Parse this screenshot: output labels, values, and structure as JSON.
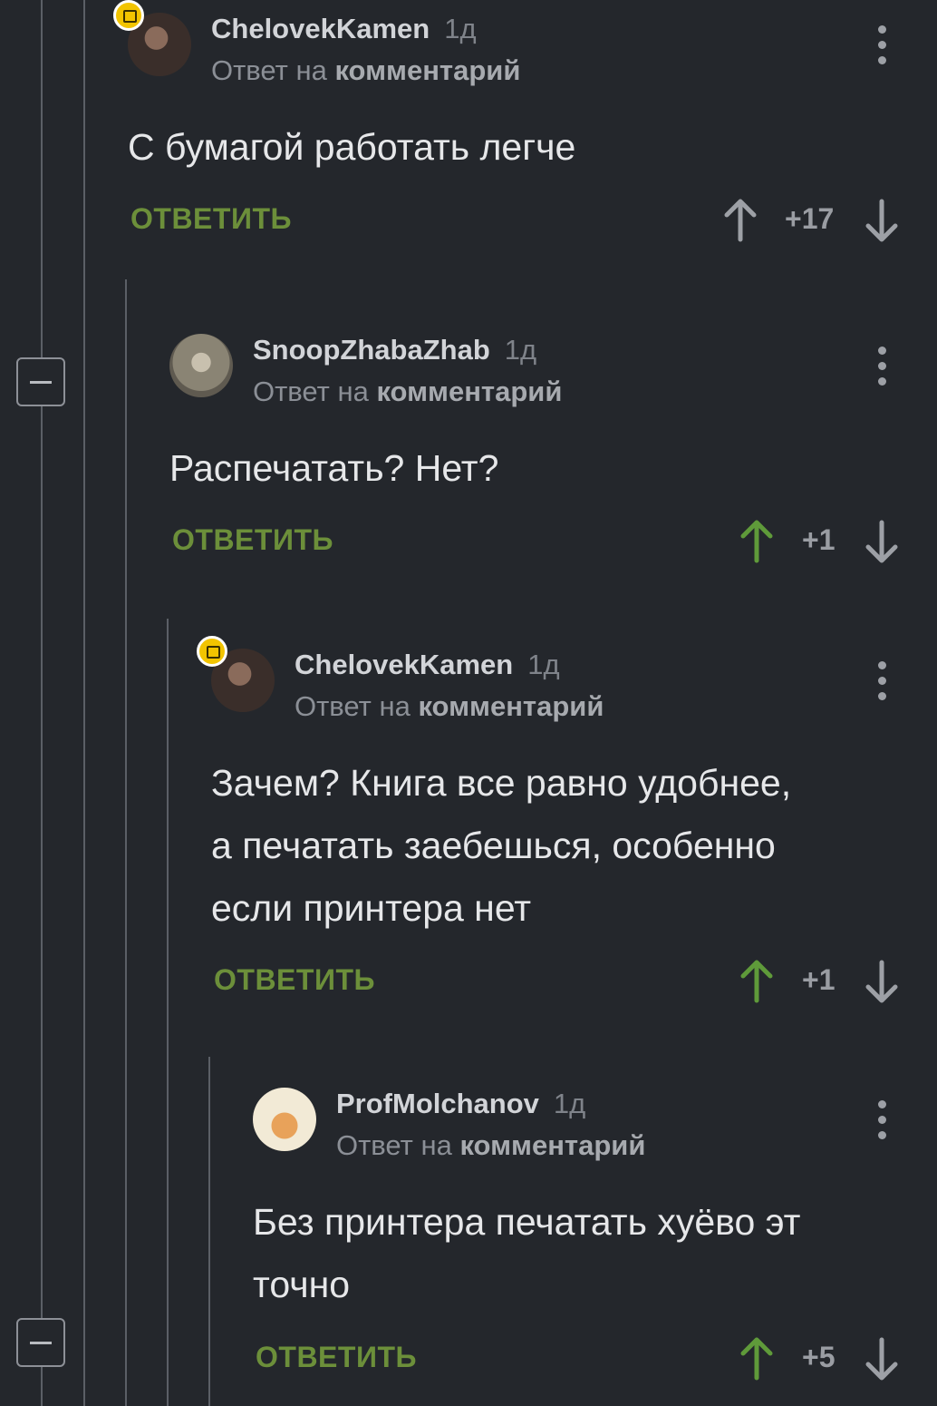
{
  "comments": [
    {
      "author": "ChelovekKamen",
      "time": "1д",
      "reply_prefix": "Ответ на",
      "reply_target": "комментарий",
      "text": "С бумагой работать легче",
      "reply_label": "ОТВЕТИТЬ",
      "rating": "+17",
      "upvoted": false
    },
    {
      "author": "SnoopZhabaZhab",
      "time": "1д",
      "reply_prefix": "Ответ на",
      "reply_target": "комментарий",
      "text": "Распечатать? Нет?",
      "reply_label": "ОТВЕТИТЬ",
      "rating": "+1",
      "upvoted": true
    },
    {
      "author": "ChelovekKamen",
      "time": "1д",
      "reply_prefix": "Ответ на",
      "reply_target": "комментарий",
      "text_lines": [
        "Зачем? Книга все равно удобнее,",
        "а печатать заебешься, особенно",
        "если принтера нет"
      ],
      "reply_label": "ОТВЕТИТЬ",
      "rating": "+1",
      "upvoted": true
    },
    {
      "author": "ProfMolchanov",
      "time": "1д",
      "reply_prefix": "Ответ на",
      "reply_target": "комментарий",
      "text_lines": [
        "Без принтера печатать хуёво эт",
        "точно"
      ],
      "reply_label": "ОТВЕТИТЬ",
      "rating": "+5",
      "upvoted": true
    }
  ],
  "colors": {
    "background": "#24272c",
    "accent_green": "#6c8f3a",
    "upvote_active": "#5f9a3a",
    "icon_gray": "#9da0a6"
  },
  "icons": [
    "collapse-icon",
    "more-icon",
    "upvote-icon",
    "downvote-icon",
    "author-badge-icon"
  ]
}
